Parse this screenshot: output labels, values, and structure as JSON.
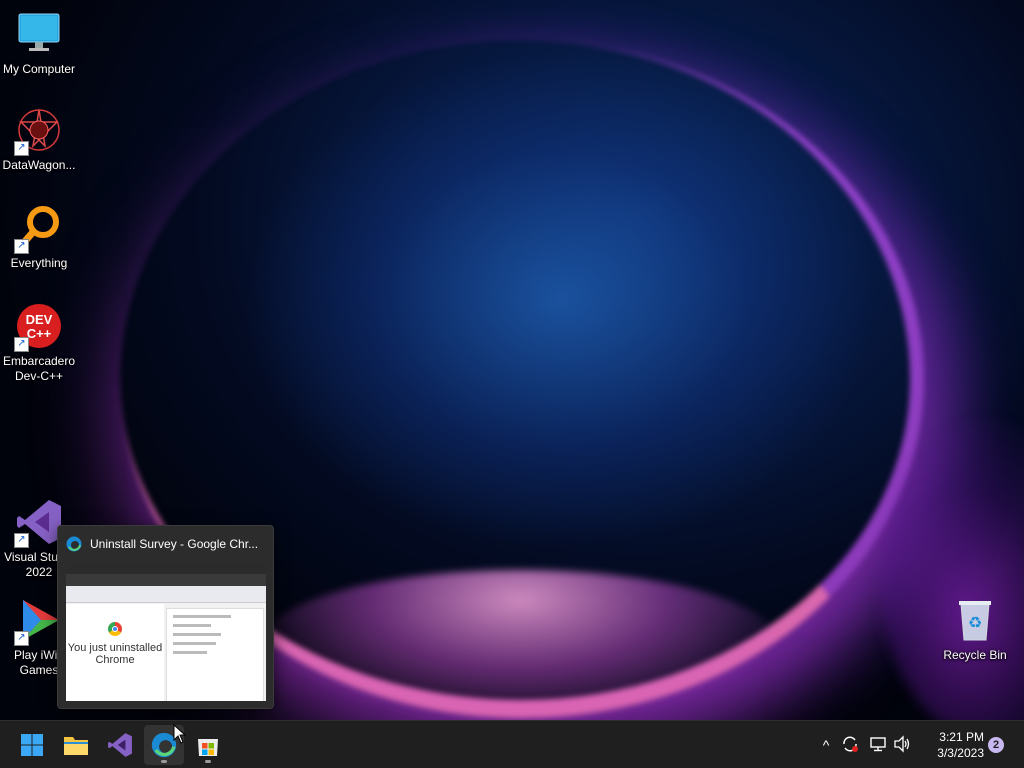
{
  "desktop": {
    "icons": [
      {
        "label": "My Computer",
        "icon": "monitor-icon"
      },
      {
        "label": "DataWagon...",
        "icon": "datawagon-icon"
      },
      {
        "label": "Everything",
        "icon": "magnifier-icon"
      },
      {
        "label": "Embarcadero Dev-C++",
        "icon": "devcpp-icon",
        "badge": "DEV C++"
      },
      {
        "label": "Visual Studio 2022",
        "icon": "visual-studio-icon"
      },
      {
        "label": "Play iWin Games",
        "icon": "play-triangle-icon"
      },
      {
        "label": "Recycle Bin",
        "icon": "recycle-bin-icon"
      }
    ]
  },
  "preview": {
    "title": "Uninstall Survey - Google Chr...",
    "thumb_text": "You just uninstalled Chrome"
  },
  "taskbar": {
    "apps": [
      "start-icon",
      "file-explorer-icon",
      "visual-studio-icon",
      "edge-icon",
      "store-icon"
    ],
    "clock_time": "3:21 PM",
    "clock_date": "3/3/2023",
    "notification_count": "2"
  }
}
